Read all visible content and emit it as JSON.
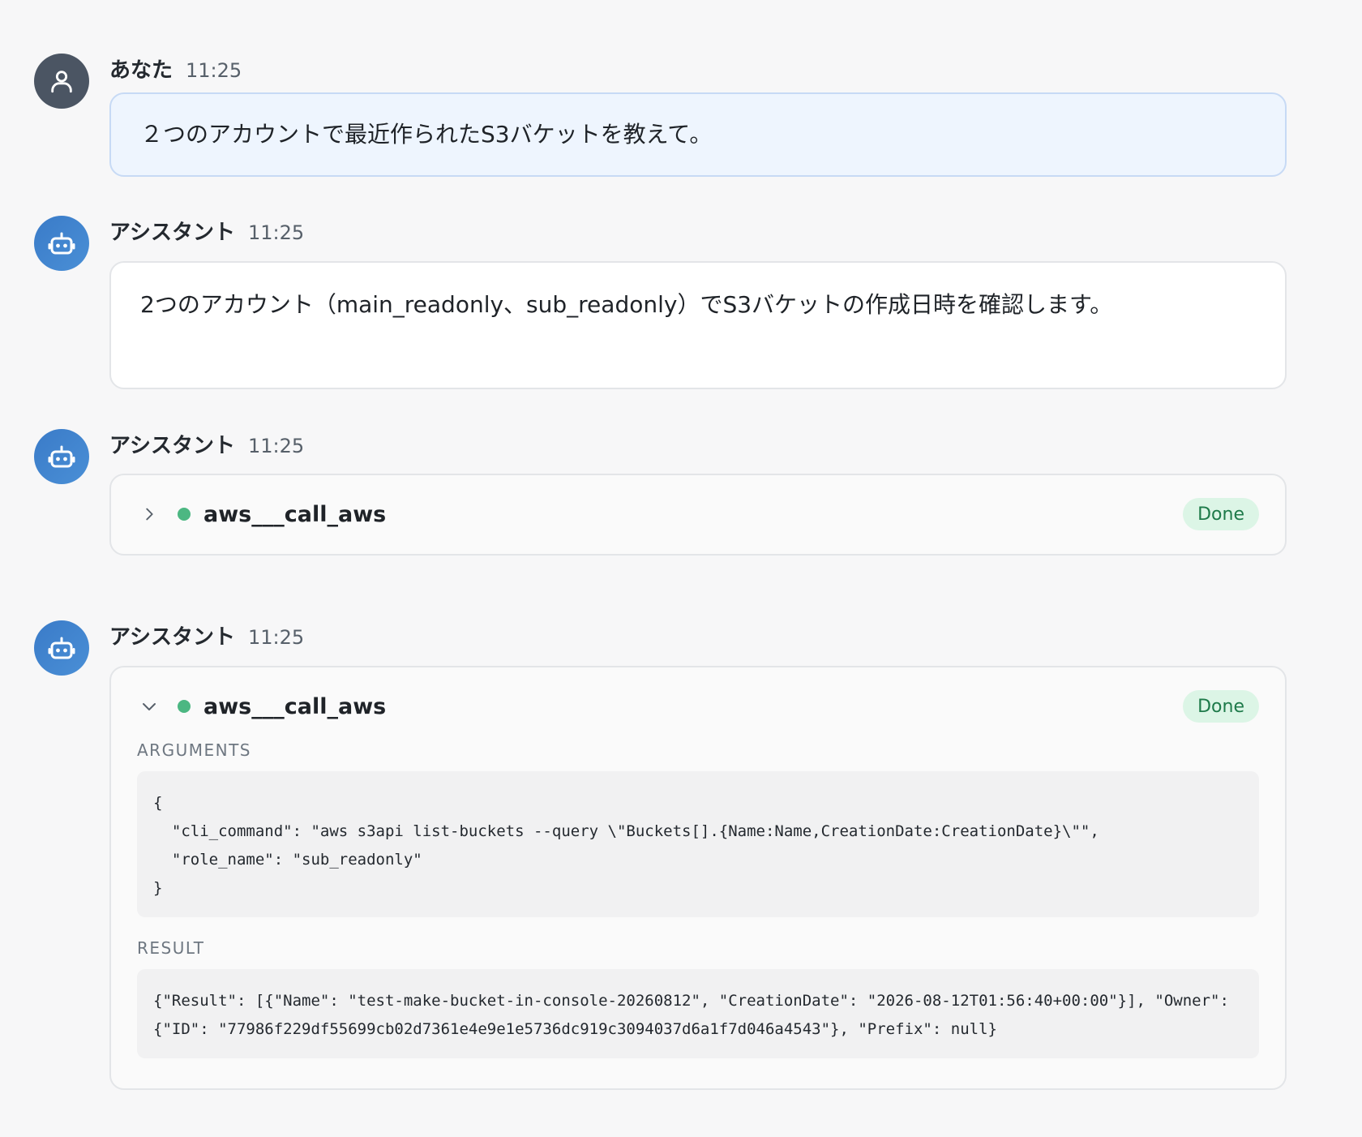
{
  "messages": {
    "user": {
      "author": "あなた",
      "time": "11:25",
      "text": "２つのアカウントで最近作られたS3バケットを教えて。"
    },
    "assistant1": {
      "author": "アシスタント",
      "time": "11:25",
      "text": "2つのアカウント（main_readonly、sub_readonly）でS3バケットの作成日時を確認します。"
    },
    "assistant2": {
      "author": "アシスタント",
      "time": "11:25",
      "tool_name": "aws___call_aws",
      "status": "Done"
    },
    "assistant3": {
      "author": "アシスタント",
      "time": "11:25",
      "tool_name": "aws___call_aws",
      "status": "Done",
      "arguments_label": "ARGUMENTS",
      "arguments": "{\n  \"cli_command\": \"aws s3api list-buckets --query \\\"Buckets[].{Name:Name,CreationDate:CreationDate}\\\"\",\n  \"role_name\": \"sub_readonly\"\n}",
      "result_label": "RESULT",
      "result": "{\"Result\": [{\"Name\": \"test-make-bucket-in-console-20260812\", \"CreationDate\": \"2026-08-12T01:56:40+00:00\"}], \"Owner\":\n{\"ID\": \"77986f229df55699cb02d7361e4e9e1e5736dc919c3094037d6a1f7d046a4543\"}, \"Prefix\": null}"
    }
  },
  "icons": {
    "user_avatar": "user-icon",
    "assistant_avatar": "robot-icon",
    "collapsed": "chevron-right-icon",
    "expanded": "chevron-down-icon",
    "status_dot": "status-dot-icon"
  },
  "colors": {
    "user_avatar": "#4b5563",
    "assistant_avatar": "#3a7bc8",
    "user_bubble": "#eef5fe",
    "status_dot": "#4cb782",
    "done_badge_bg": "#dcf5e6",
    "done_badge_text": "#1e7a4a"
  }
}
